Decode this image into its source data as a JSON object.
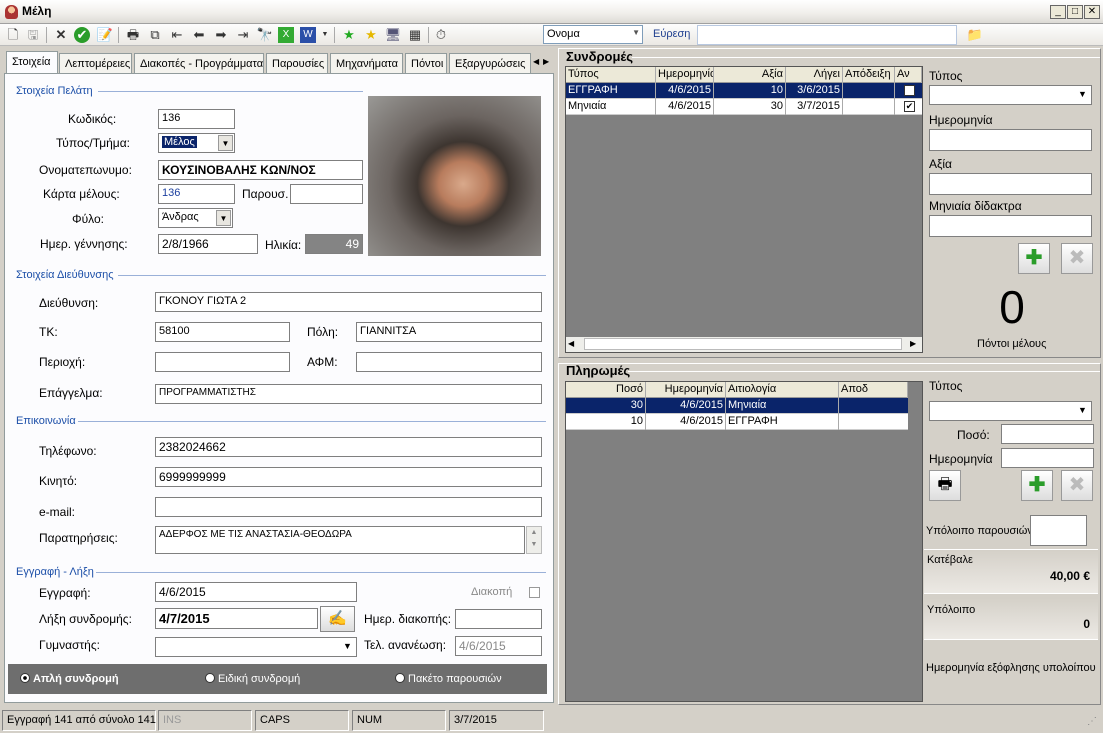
{
  "window": {
    "title": "Μέλη"
  },
  "toolbar": {
    "search_field": "Ονομα",
    "search_label": "Εύρεση",
    "search_value": ""
  },
  "tabs": [
    "Στοιχεία",
    "Λεπτομέρειες",
    "Διακοπές - Προγράμματα",
    "Παρουσίες",
    "Μηχανήματα",
    "Πόντοι",
    "Εξαργυρώσεις"
  ],
  "member": {
    "section_title": "Στοιχεία Πελάτη",
    "code_label": "Κωδικός:",
    "code": "136",
    "type_label": "Τύπος/Τμήμα:",
    "type": "Μέλος",
    "name_label": "Ονοματεπωνυμο:",
    "name": "ΚΟΥΣΙΝΟΒΑΛΗΣ ΚΩΝ/ΝΟΣ",
    "card_label": "Κάρτα μέλους:",
    "card": "136",
    "presence_label": "Παρουσ.",
    "presence": "",
    "gender_label": "Φύλο:",
    "gender": "Άνδρας",
    "birth_label": "Ημερ. γέννησης:",
    "birth": "2/8/1966",
    "age_label": "Ηλικία:",
    "age": "49"
  },
  "address": {
    "section_title": "Στοιχεία Διεύθυνσης",
    "street_label": "Διεύθυνση:",
    "street": "ΓΚΟΝΟΥ ΓΙΩΤΑ 2",
    "zip_label": "ΤΚ:",
    "zip": "58100",
    "city_label": "Πόλη:",
    "city": "ΓΙΑΝΝΙΤΣΑ",
    "area_label": "Περιοχή:",
    "area": "",
    "afm_label": "ΑΦΜ:",
    "afm": "",
    "job_label": "Επάγγελμα:",
    "job": "ΠΡΟΓΡΑΜΜΑΤΙΣΤΗΣ"
  },
  "contact": {
    "section_title": "Επικοινωνία",
    "phone_label": "Τηλέφωνο:",
    "phone": "2382024662",
    "mobile_label": "Κινητό:",
    "mobile": "6999999999",
    "email_label": "e-mail:",
    "email": "",
    "notes_label": "Παρατηρήσεις:",
    "notes": "ΑΔΕΡΦΟΣ ΜΕ ΤΙΣ ΑΝΑΣΤΑΣΙΑ-ΘΕΟΔΩΡΑ"
  },
  "registration": {
    "section_title": "Εγγραφή - Λήξη",
    "reg_label": "Εγγραφή:",
    "reg": "4/6/2015",
    "pause_label": "Διακοπή",
    "expiry_label": "Λήξη συνδρομής:",
    "expiry": "4/7/2015",
    "pause_date_label": "Ημερ. διακοπής:",
    "pause_date": "",
    "trainer_label": "Γυμναστής:",
    "trainer": "",
    "renew_label": "Τελ. ανανέωση:",
    "renew": "4/6/2015"
  },
  "subscription_types": [
    "Απλή συνδρομή",
    "Ειδική συνδρομή",
    "Πακέτο παρουσιών"
  ],
  "subscriptions": {
    "title": "Συνδρομές",
    "columns": [
      "Τύπος",
      "Ημερομηνία",
      "Αξία",
      "Λήγει",
      "Απόδειξη",
      "Αν"
    ],
    "rows": [
      {
        "type": "ΕΓΓΡΑΦΗ",
        "date": "4/6/2015",
        "value": "10",
        "expires": "3/6/2015",
        "receipt": "",
        "checked": false
      },
      {
        "type": "Μηνιαία",
        "date": "4/6/2015",
        "value": "30",
        "expires": "3/7/2015",
        "receipt": "",
        "checked": true
      }
    ],
    "form": {
      "type_label": "Τύπος",
      "date_label": "Ημερομηνία",
      "value_label": "Αξία",
      "monthly_label": "Μηνιαία δίδακτρα"
    },
    "points": "0",
    "points_label": "Πόντοι μέλους"
  },
  "payments": {
    "title": "Πληρωμές",
    "columns": [
      "Ποσό",
      "Ημερομηνία",
      "Αιτιολογία",
      "Αποδ"
    ],
    "rows": [
      {
        "amount": "30",
        "date": "4/6/2015",
        "reason": "Μηνιαία"
      },
      {
        "amount": "10",
        "date": "4/6/2015",
        "reason": "ΕΓΓΡΑΦΗ"
      }
    ],
    "form": {
      "type_label": "Τύπος",
      "amount_label": "Ποσό:",
      "date_label": "Ημερομηνία"
    },
    "remaining_presence_label": "Υπόλοιπο παρουσιών",
    "paid_label": "Κατέβαλε",
    "paid": "40,00 €",
    "balance_label": "Υπόλοιπο",
    "balance": "0",
    "settle_label": "Ημερομηνία εξόφλησης υπολοίπου"
  },
  "status": {
    "record": "Εγγραφή 141 από σύνολο 141",
    "ins": "INS",
    "caps": "CAPS",
    "num": "NUM",
    "date": "3/7/2015"
  }
}
